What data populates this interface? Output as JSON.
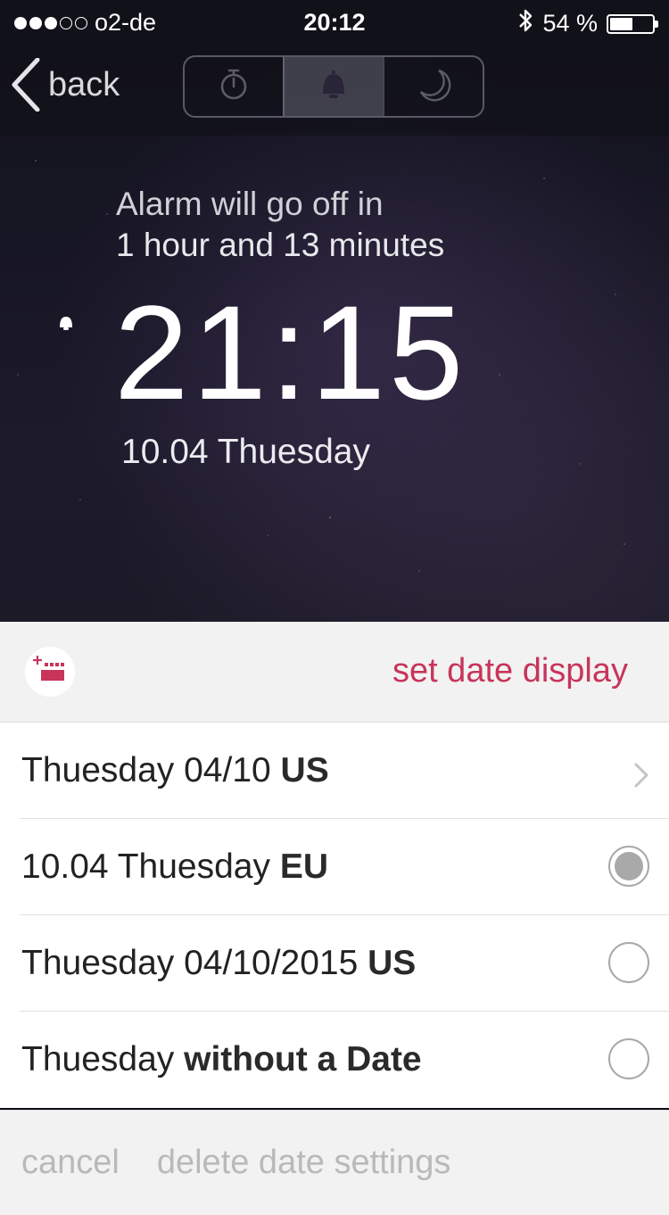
{
  "status_bar": {
    "carrier": "o2-de",
    "signal_bars_filled": 3,
    "signal_bars_total": 5,
    "time": "20:12",
    "battery_text": "54 %",
    "battery_level": 0.54
  },
  "nav": {
    "back_label": "back",
    "segments": [
      {
        "icon": "stopwatch-icon",
        "active": false
      },
      {
        "icon": "bell-icon",
        "active": true
      },
      {
        "icon": "moon-icon",
        "active": false
      }
    ]
  },
  "alarm": {
    "countdown_line1": "Alarm will go off in",
    "countdown_line2": "1 hour and 13 minutes",
    "time": "21:15",
    "date": "10.04 Thuesday"
  },
  "date_panel": {
    "title": "set date display",
    "accent_color": "#c8355a",
    "options": [
      {
        "text": "Thuesday 04/10 ",
        "bold": "US",
        "control": "chevron",
        "selected": false
      },
      {
        "text": "10.04 Thuesday ",
        "bold": "EU",
        "control": "radio",
        "selected": true
      },
      {
        "text": "Thuesday 04/10/2015 ",
        "bold": "US",
        "control": "radio",
        "selected": false
      },
      {
        "text": "Thuesday ",
        "bold": "without a Date",
        "control": "radio",
        "selected": false
      }
    ]
  },
  "footer": {
    "cancel_label": "cancel",
    "delete_label": "delete date settings"
  }
}
